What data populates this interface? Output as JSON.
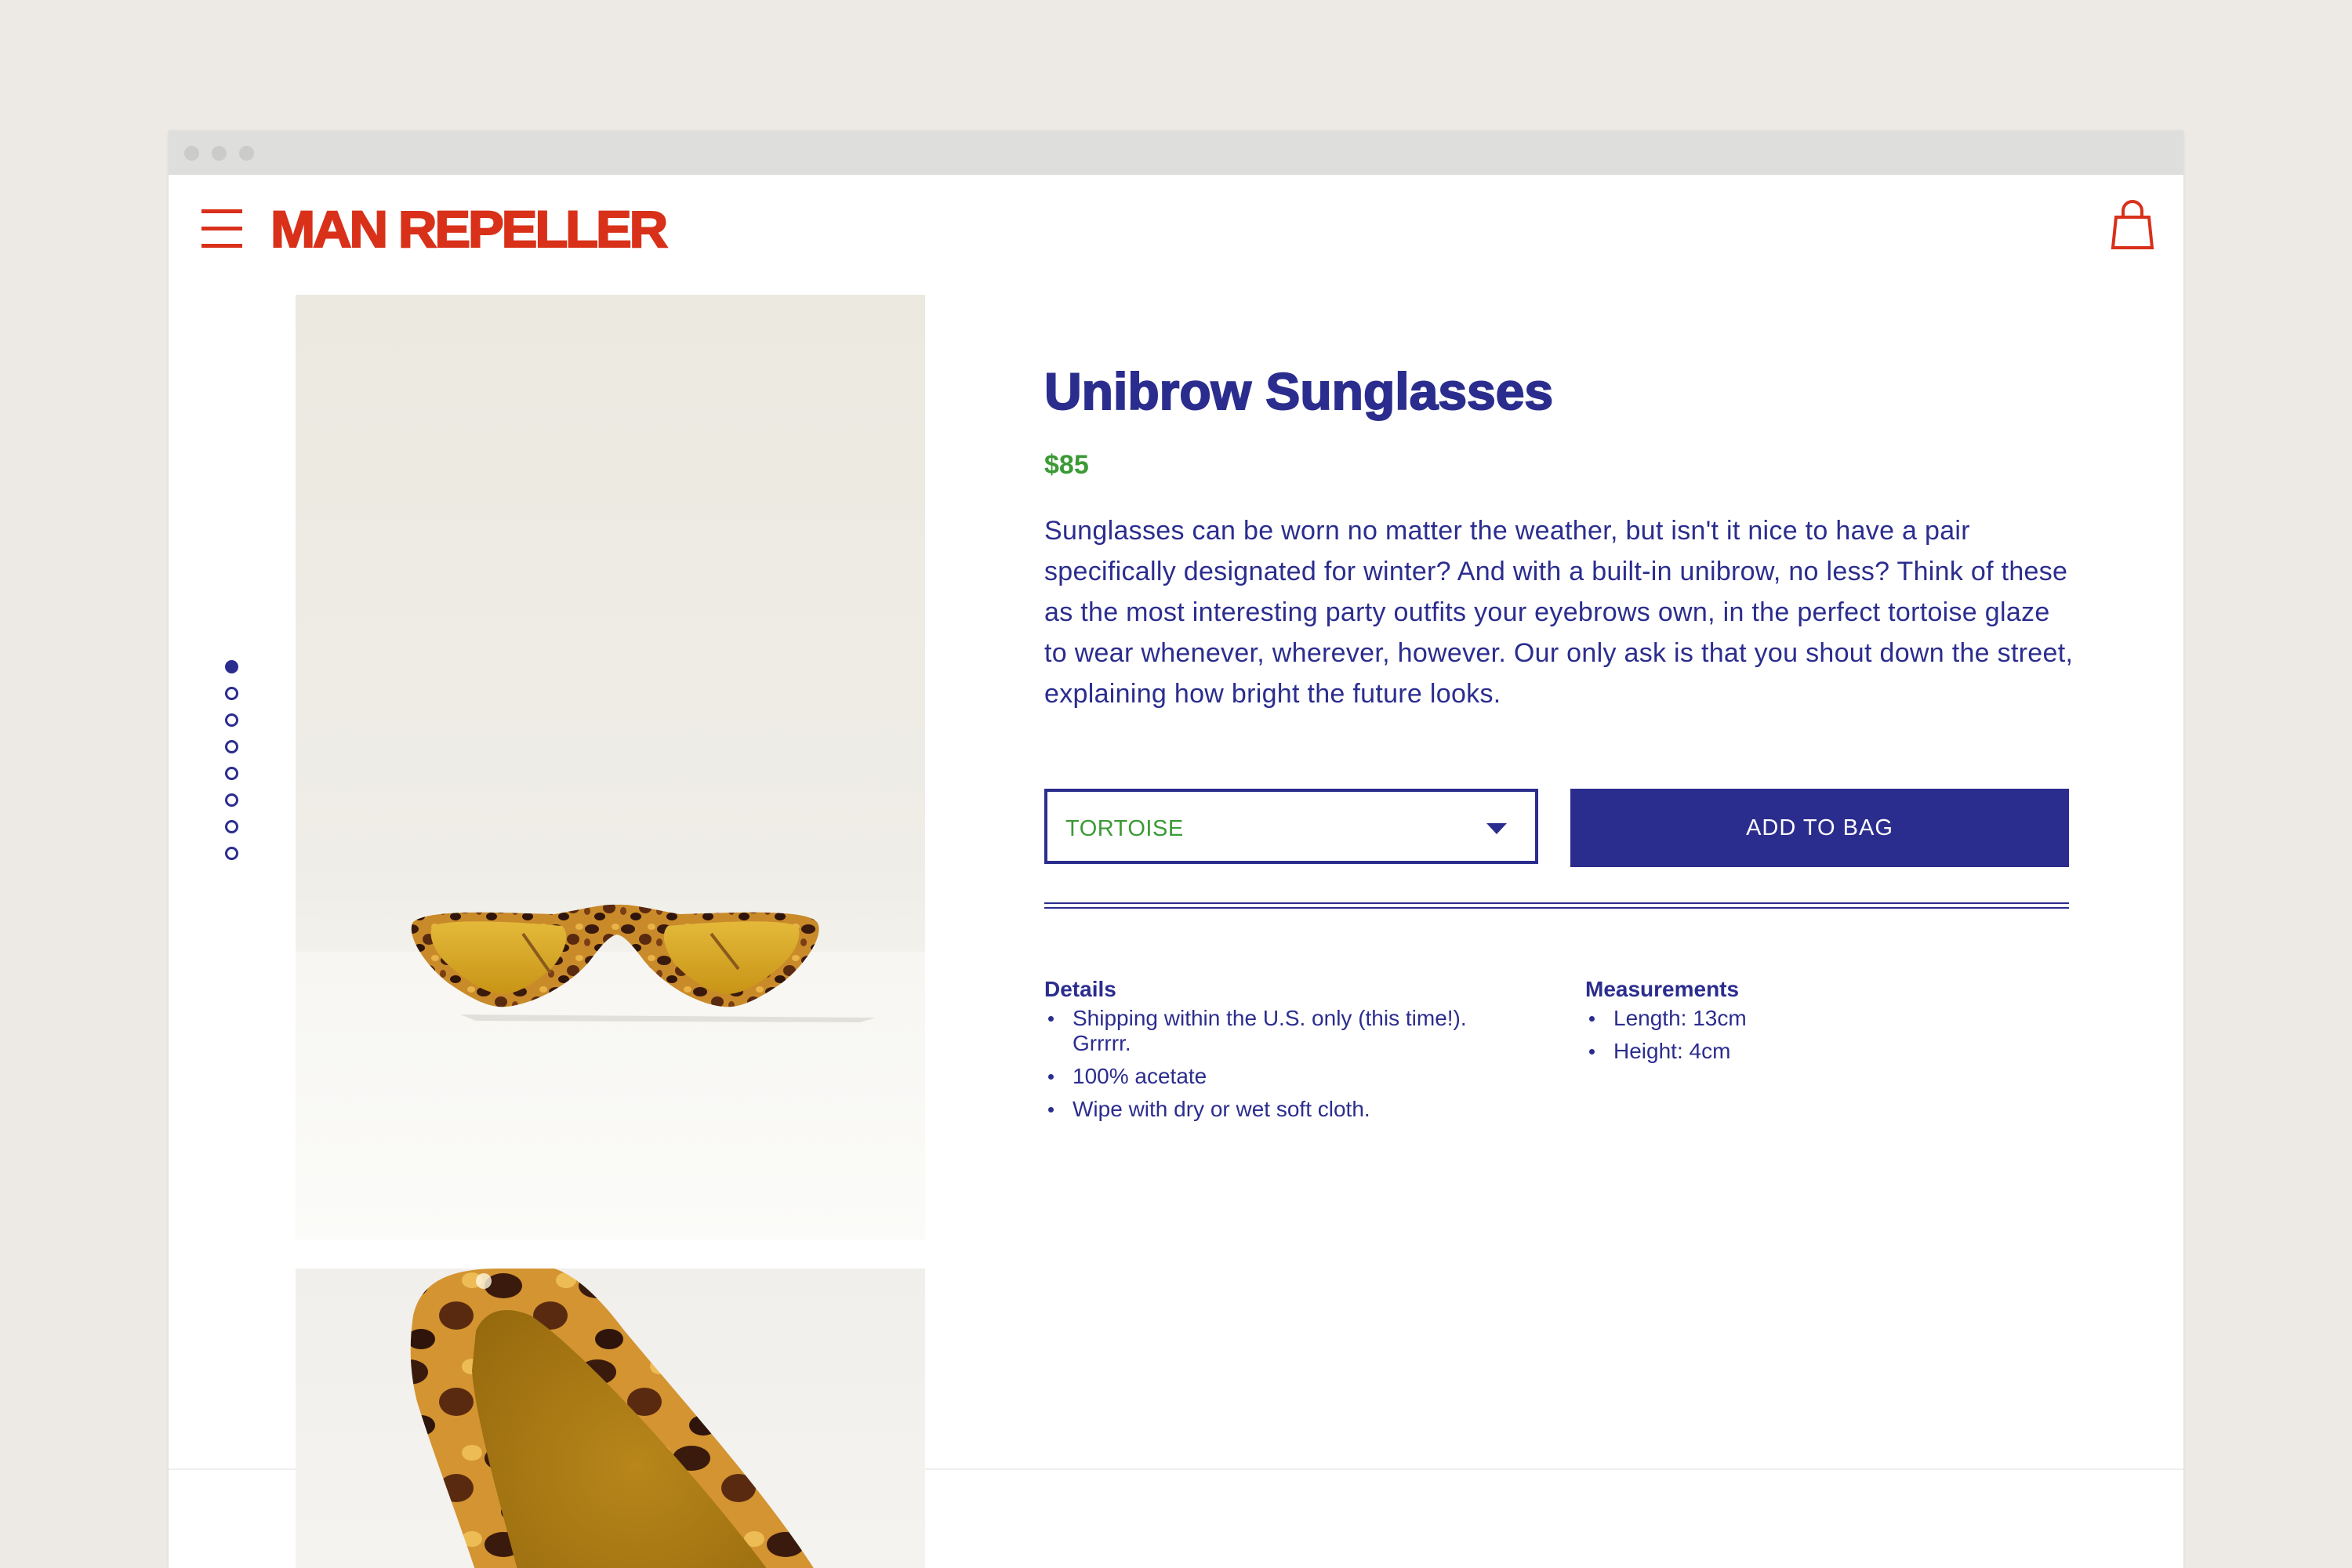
{
  "header": {
    "menu_icon": "hamburger-icon",
    "logo": "MAN REPELLER",
    "bag_icon": "shopping-bag-icon"
  },
  "gallery": {
    "total_images": 8,
    "active_index": 0,
    "images": [
      {
        "subject": "tortoise-sunglasses-front"
      },
      {
        "subject": "tortoise-sunglasses-closeup"
      }
    ]
  },
  "product": {
    "title": "Unibrow Sunglasses",
    "price": "$85",
    "description": "Sunglasses can be worn no matter the weather, but isn't it nice to have a pair specifically designated for winter? And with a built-in unibrow, no less? Think of these as the most interesting party outfits your eyebrows own, in the perfect tortoise glaze to wear whenever, wherever, however. Our only ask is that you shout down the street, explaining how bright the future looks.",
    "color_select": {
      "value": "TORTOISE",
      "icon": "chevron-down-icon"
    },
    "add_to_bag_label": "ADD TO BAG",
    "details": {
      "heading": "Details",
      "items": [
        "Shipping within the U.S. only (this time!). Grrrrr.",
        "100% acetate",
        "Wipe with dry or wet soft cloth."
      ]
    },
    "measurements": {
      "heading": "Measurements",
      "items": [
        "Length: 13cm",
        "Height: 4cm"
      ]
    }
  },
  "colors": {
    "brand_red": "#d9301a",
    "navy": "#2b2d8e",
    "price_green": "#3b9a35",
    "page_background": "#edeae5"
  }
}
